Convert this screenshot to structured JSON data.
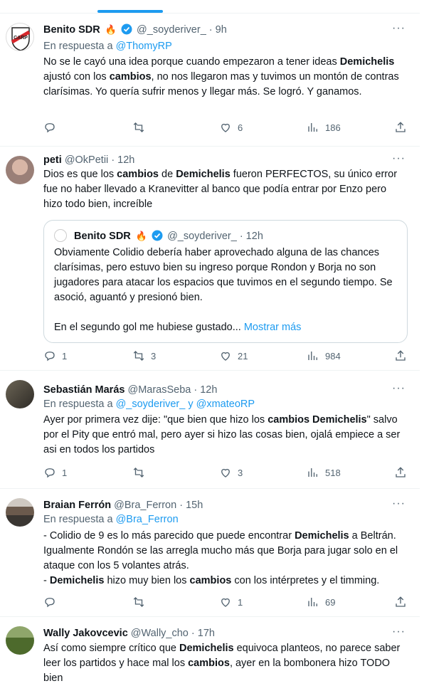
{
  "tweets": [
    {
      "name": "Benito SDR",
      "handle": "@_soyderiver_",
      "time": "· 9h",
      "reply_prefix": "En respuesta a",
      "reply_to": "@ThomyRP",
      "text_html": "No se le cayó una idea porque cuando empezaron a tener ideas <b>Demichelis</b> ajustó con los <b>cambios</b>, no nos llegaron mas y tuvimos un montón de contras clarísimas. Yo quería sufrir menos y llegar más. Se logró. Y ganamos.",
      "replies": "",
      "retweets": "",
      "likes": "6",
      "views": "186"
    },
    {
      "name": "peti",
      "handle": "@OkPetii",
      "time": "· 12h",
      "text_html": "Dios es que los <b>cambios</b> de <b>Demichelis</b> fueron PERFECTOS, su único error fue no haber llevado a Kranevitter al banco que podía entrar por Enzo pero hizo todo bien, increíble",
      "quote": {
        "name": "Benito SDR",
        "handle": "@_soyderiver_",
        "time": "· 12h",
        "text_html": "Obviamente Colidio debería haber aprovechado alguna de las chances clarísimas, pero estuvo bien su ingreso porque Rondon y Borja no son jugadores para atacar los espacios que tuvimos en el segundo tiempo. Se asoció, aguantó y presionó bien.<br><br>En el segundo gol me hubiese gustado... <span class=\"more-link\">Mostrar más</span>"
      },
      "replies": "1",
      "retweets": "3",
      "likes": "21",
      "views": "984"
    },
    {
      "name": "Sebastián Marás",
      "handle": "@MarasSeba",
      "time": "· 12h",
      "reply_prefix": "En respuesta a",
      "reply_to": "@_soyderiver_ y @xmateoRP",
      "text_html": "Ayer por primera vez dije: \"que bien que hizo los <b>cambios Demichelis</b>\" salvo por el Pity que entró mal, pero ayer si hizo las cosas bien, ojalá empiece a ser asi en todos los partidos",
      "replies": "1",
      "retweets": "",
      "likes": "3",
      "views": "518"
    },
    {
      "name": "Braian Ferrón",
      "handle": "@Bra_Ferron",
      "time": "· 15h",
      "reply_prefix": "En respuesta a",
      "reply_to": "@Bra_Ferron",
      "text_html": "- Colidio de 9 es lo más parecido que puede encontrar <b>Demichelis</b> a Beltrán. Igualmente Rondón se las arregla mucho más que Borja para jugar solo en el ataque con los 5 volantes atrás.<br>- <b>Demichelis</b> hizo muy bien los <b>cambios</b> con los intérpretes y el timming.",
      "replies": "",
      "retweets": "",
      "likes": "1",
      "views": "69"
    },
    {
      "name": "Wally Jakovcevic",
      "handle": "@Wally_cho",
      "time": "· 17h",
      "text_html": "Así como siempre crítico que <b>Demichelis</b> equivoca planteos, no parece saber leer los partidos y hace mal los <b>cambios</b>, ayer en la bombonera hizo TODO bien"
    }
  ],
  "icons": [
    "reply-icon",
    "retweet-icon",
    "like-icon",
    "views-icon",
    "share-icon",
    "more-icon",
    "verified-icon"
  ],
  "colors": {
    "accent": "#1d9bf0",
    "muted": "#536471",
    "text": "#0f1419",
    "border": "#eff3f4"
  }
}
